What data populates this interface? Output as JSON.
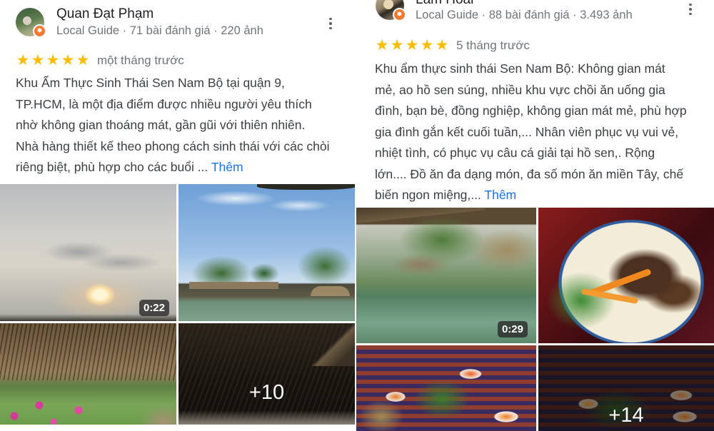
{
  "reviews": [
    {
      "reviewer_name": "Quan Đạt Phạm",
      "reviewer_meta": "Local Guide · 71 bài đánh giá · 220 ảnh",
      "badge_icon": "local-guide-star-icon",
      "rating": 5,
      "stars": [
        "★",
        "★",
        "★",
        "★",
        "★"
      ],
      "time_ago": "một tháng trước",
      "text": "Khu Ẩm Thực Sinh Thái Sen Nam Bộ tại quận 9, TP.HCM, là một địa điểm được nhiều người yêu thích nhờ không gian thoáng mát, gần gũi với thiên nhiên. Nhà hàng thiết kế theo phong cách sinh thái với các chòi riêng biệt, phù hợp cho các buổi ... ",
      "more_label": "Thêm",
      "media": [
        {
          "type": "video",
          "duration": "0:22",
          "subject": "cloudy sky sunset"
        },
        {
          "type": "photo",
          "subject": "thatched huts by lotus pond"
        },
        {
          "type": "photo",
          "subject": "thatched roof with bougainvillea"
        },
        {
          "type": "photo",
          "subject": "thatched roof interior",
          "more_count": "+10"
        }
      ]
    },
    {
      "reviewer_name": "Lâm Hoài",
      "reviewer_meta": "Local Guide · 88 bài đánh giá · 3.493 ảnh",
      "badge_icon": "local-guide-star-icon",
      "rating": 5,
      "stars": [
        "★",
        "★",
        "★",
        "★",
        "★"
      ],
      "time_ago": "5 tháng trước",
      "text": "Khu ẩm thực sinh thái Sen Nam Bộ: Không gian mát mẻ, ao hồ sen súng, nhiều khu vực chồi ăn uống gia đình, bạn bè, đồng nghiệp, không gian mát mẻ, phù hợp gia đình gắn kết cuối tuần,... Nhân viên phục vụ vui vẻ, nhiệt tình, có phục vụ câu cá giải tại hồ sen,. Rộng lớn.... Đồ ăn đa dạng món, đa số món ăn miền Tây, chế biến ngon miệng,... ",
      "more_label": "Thêm",
      "media": [
        {
          "type": "video",
          "duration": "0:29",
          "subject": "lotus pond with thatched huts"
        },
        {
          "type": "photo",
          "subject": "grilled meat with herbs and carrot"
        },
        {
          "type": "photo",
          "subject": "table with dishes and dipping sauces"
        },
        {
          "type": "photo",
          "subject": "table with dishes",
          "more_count": "+14"
        }
      ]
    }
  ],
  "colors": {
    "star": "#fbbc04",
    "link": "#1a73e8",
    "name_text": "#202124",
    "meta_text": "#70757a",
    "body_text": "#3c4043",
    "local_guide_badge": "#f47a33"
  }
}
